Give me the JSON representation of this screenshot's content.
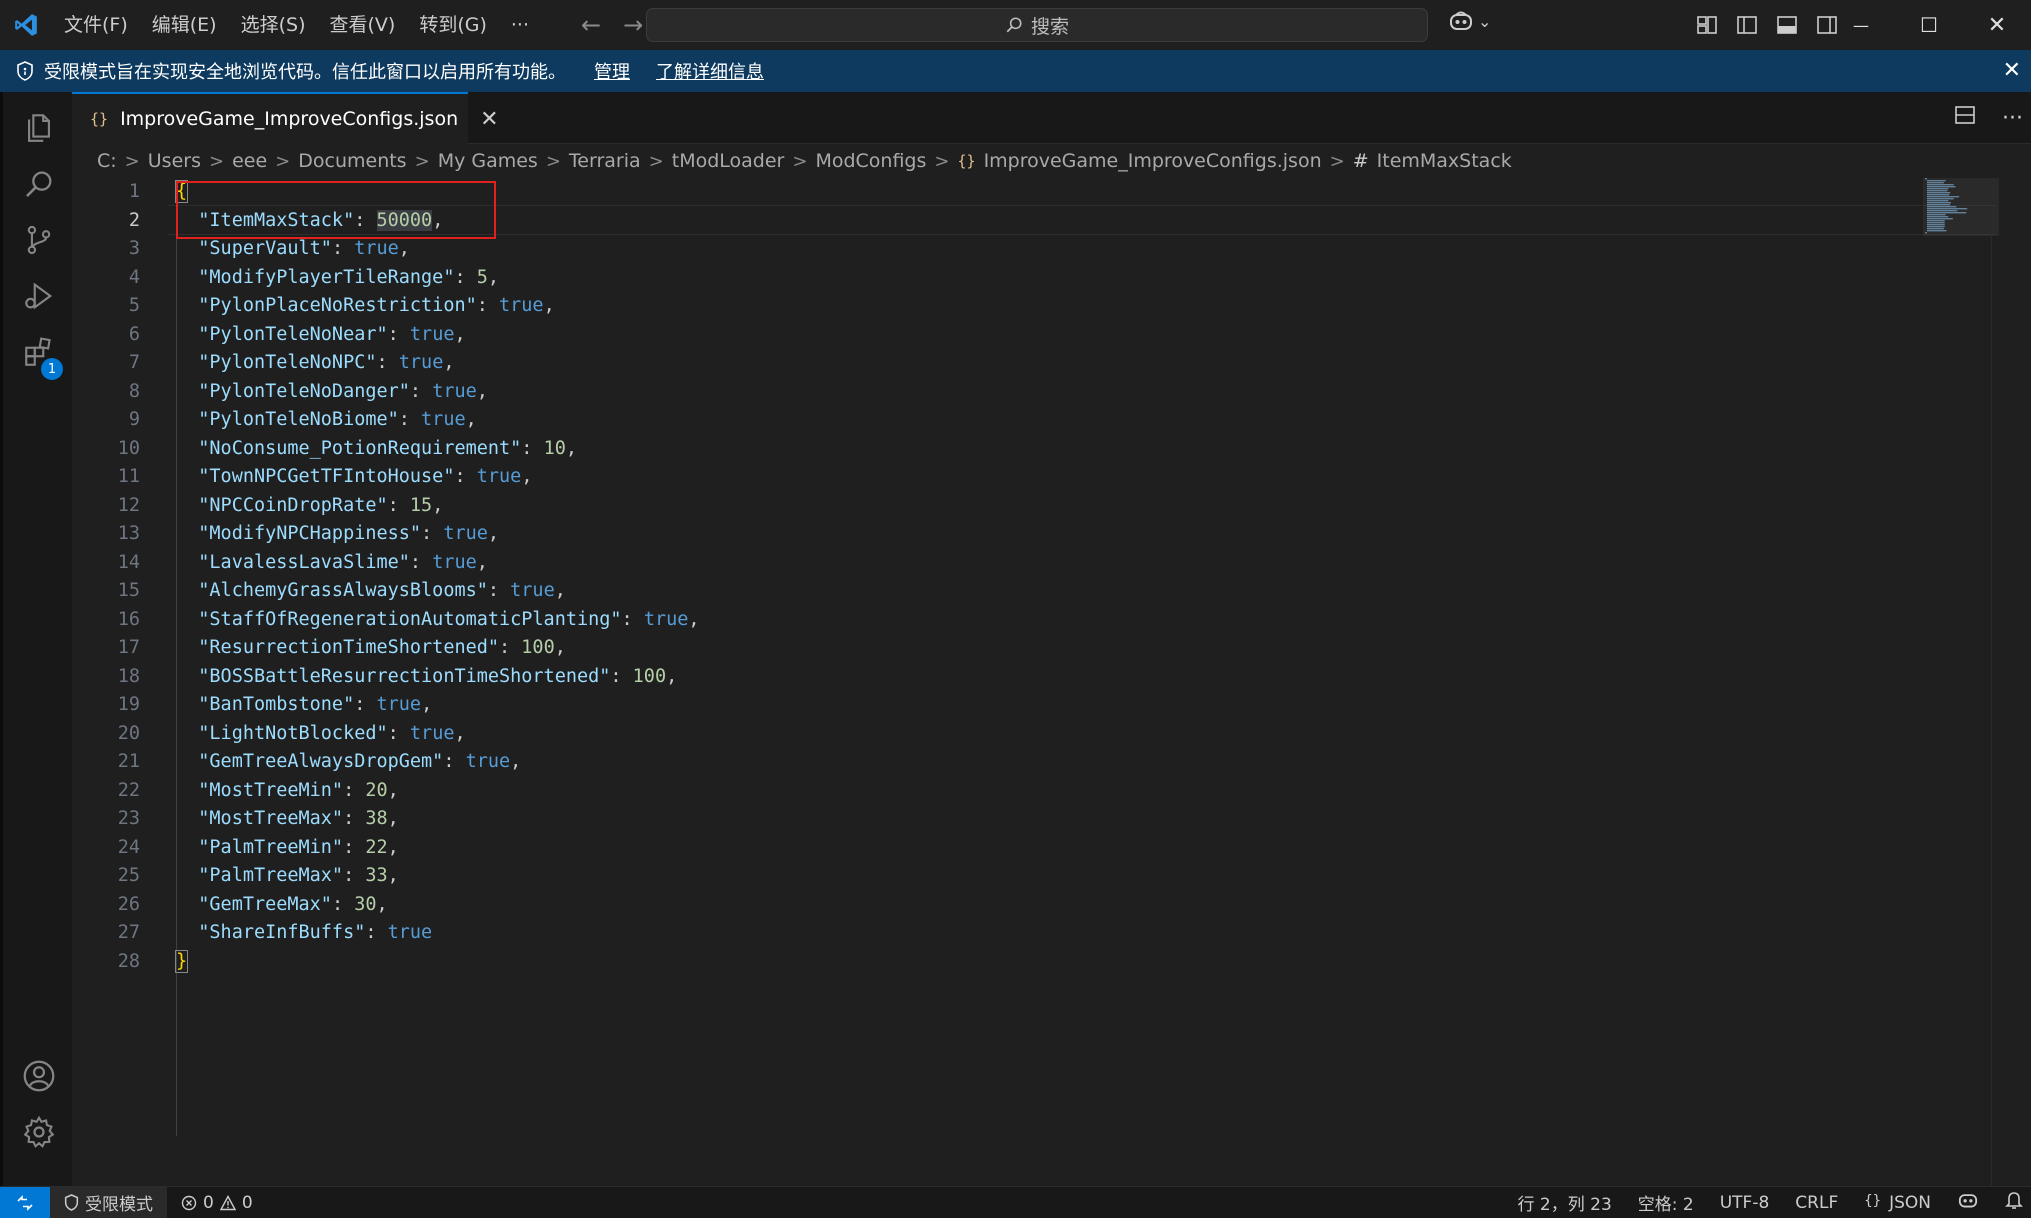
{
  "titlebar": {
    "menu": [
      "文件(F)",
      "编辑(E)",
      "选择(S)",
      "查看(V)",
      "转到(G)",
      "···"
    ],
    "back_glyph": "←",
    "forward_glyph": "→",
    "search_placeholder": "搜索",
    "copilot_chevron": "⌄",
    "minimize_glyph": "—",
    "maximize_glyph": "☐",
    "close_glyph": "✕"
  },
  "banner": {
    "message": "受限模式旨在实现安全地浏览代码。信任此窗口以启用所有功能。",
    "manage_link": "管理",
    "details_link": "了解详细信息",
    "close_glyph": "✕"
  },
  "activitybar": {
    "items": [
      "explorer-icon",
      "search-icon",
      "source-control-icon",
      "run-debug-icon",
      "extensions-icon"
    ],
    "extensions_badge": "1",
    "bottom_items": [
      "accounts-icon",
      "settings-gear-icon"
    ]
  },
  "tab": {
    "icon_glyph": "{}",
    "filename": "ImproveGame_ImproveConfigs.json",
    "close_glyph": "✕",
    "actions_more": "···"
  },
  "breadcrumb": {
    "parts": [
      "C:",
      "Users",
      "eee",
      "Documents",
      "My Games",
      "Terraria",
      "tModLoader",
      "ModConfigs"
    ],
    "separator": ">",
    "file_icon_glyph": "{}",
    "file": "ImproveGame_ImproveConfigs.json",
    "symbol_glyph": "#",
    "symbol": "ItemMaxStack"
  },
  "editor": {
    "open_brace": "{",
    "close_brace": "}",
    "entries": [
      {
        "key": "\"ItemMaxStack\"",
        "value": "50000",
        "type": "num"
      },
      {
        "key": "\"SuperVault\"",
        "value": "true",
        "type": "bool"
      },
      {
        "key": "\"ModifyPlayerTileRange\"",
        "value": "5",
        "type": "num"
      },
      {
        "key": "\"PylonPlaceNoRestriction\"",
        "value": "true",
        "type": "bool"
      },
      {
        "key": "\"PylonTeleNoNear\"",
        "value": "true",
        "type": "bool"
      },
      {
        "key": "\"PylonTeleNoNPC\"",
        "value": "true",
        "type": "bool"
      },
      {
        "key": "\"PylonTeleNoDanger\"",
        "value": "true",
        "type": "bool"
      },
      {
        "key": "\"PylonTeleNoBiome\"",
        "value": "true",
        "type": "bool"
      },
      {
        "key": "\"NoConsume_PotionRequirement\"",
        "value": "10",
        "type": "num"
      },
      {
        "key": "\"TownNPCGetTFIntoHouse\"",
        "value": "true",
        "type": "bool"
      },
      {
        "key": "\"NPCCoinDropRate\"",
        "value": "15",
        "type": "num"
      },
      {
        "key": "\"ModifyNPCHappiness\"",
        "value": "true",
        "type": "bool"
      },
      {
        "key": "\"LavalessLavaSlime\"",
        "value": "true",
        "type": "bool"
      },
      {
        "key": "\"AlchemyGrassAlwaysBlooms\"",
        "value": "true",
        "type": "bool"
      },
      {
        "key": "\"StaffOfRegenerationAutomaticPlanting\"",
        "value": "true",
        "type": "bool"
      },
      {
        "key": "\"ResurrectionTimeShortened\"",
        "value": "100",
        "type": "num"
      },
      {
        "key": "\"BOSSBattleResurrectionTimeShortened\"",
        "value": "100",
        "type": "num"
      },
      {
        "key": "\"BanTombstone\"",
        "value": "true",
        "type": "bool"
      },
      {
        "key": "\"LightNotBlocked\"",
        "value": "true",
        "type": "bool"
      },
      {
        "key": "\"GemTreeAlwaysDropGem\"",
        "value": "true",
        "type": "bool"
      },
      {
        "key": "\"MostTreeMin\"",
        "value": "20",
        "type": "num"
      },
      {
        "key": "\"MostTreeMax\"",
        "value": "38",
        "type": "num"
      },
      {
        "key": "\"PalmTreeMin\"",
        "value": "22",
        "type": "num"
      },
      {
        "key": "\"PalmTreeMax\"",
        "value": "33",
        "type": "num"
      },
      {
        "key": "\"GemTreeMax\"",
        "value": "30",
        "type": "num"
      },
      {
        "key": "\"ShareInfBuffs\"",
        "value": "true",
        "type": "bool"
      }
    ],
    "active_line": 2
  },
  "statusbar": {
    "restricted_mode": "受限模式",
    "errors": "0",
    "warnings": "0",
    "cursor_position": "行 2，列 23",
    "indentation": "空格: 2",
    "encoding": "UTF-8",
    "line_ending": "CRLF",
    "language_glyph": "{}",
    "language": "JSON"
  },
  "colors": {
    "accent": "#0078d4",
    "banner": "#0d3a5e",
    "highlight_box": "#e0221c",
    "json_key": "#9cdcfe",
    "json_number": "#b5cea8",
    "json_boolean": "#569cd6"
  }
}
